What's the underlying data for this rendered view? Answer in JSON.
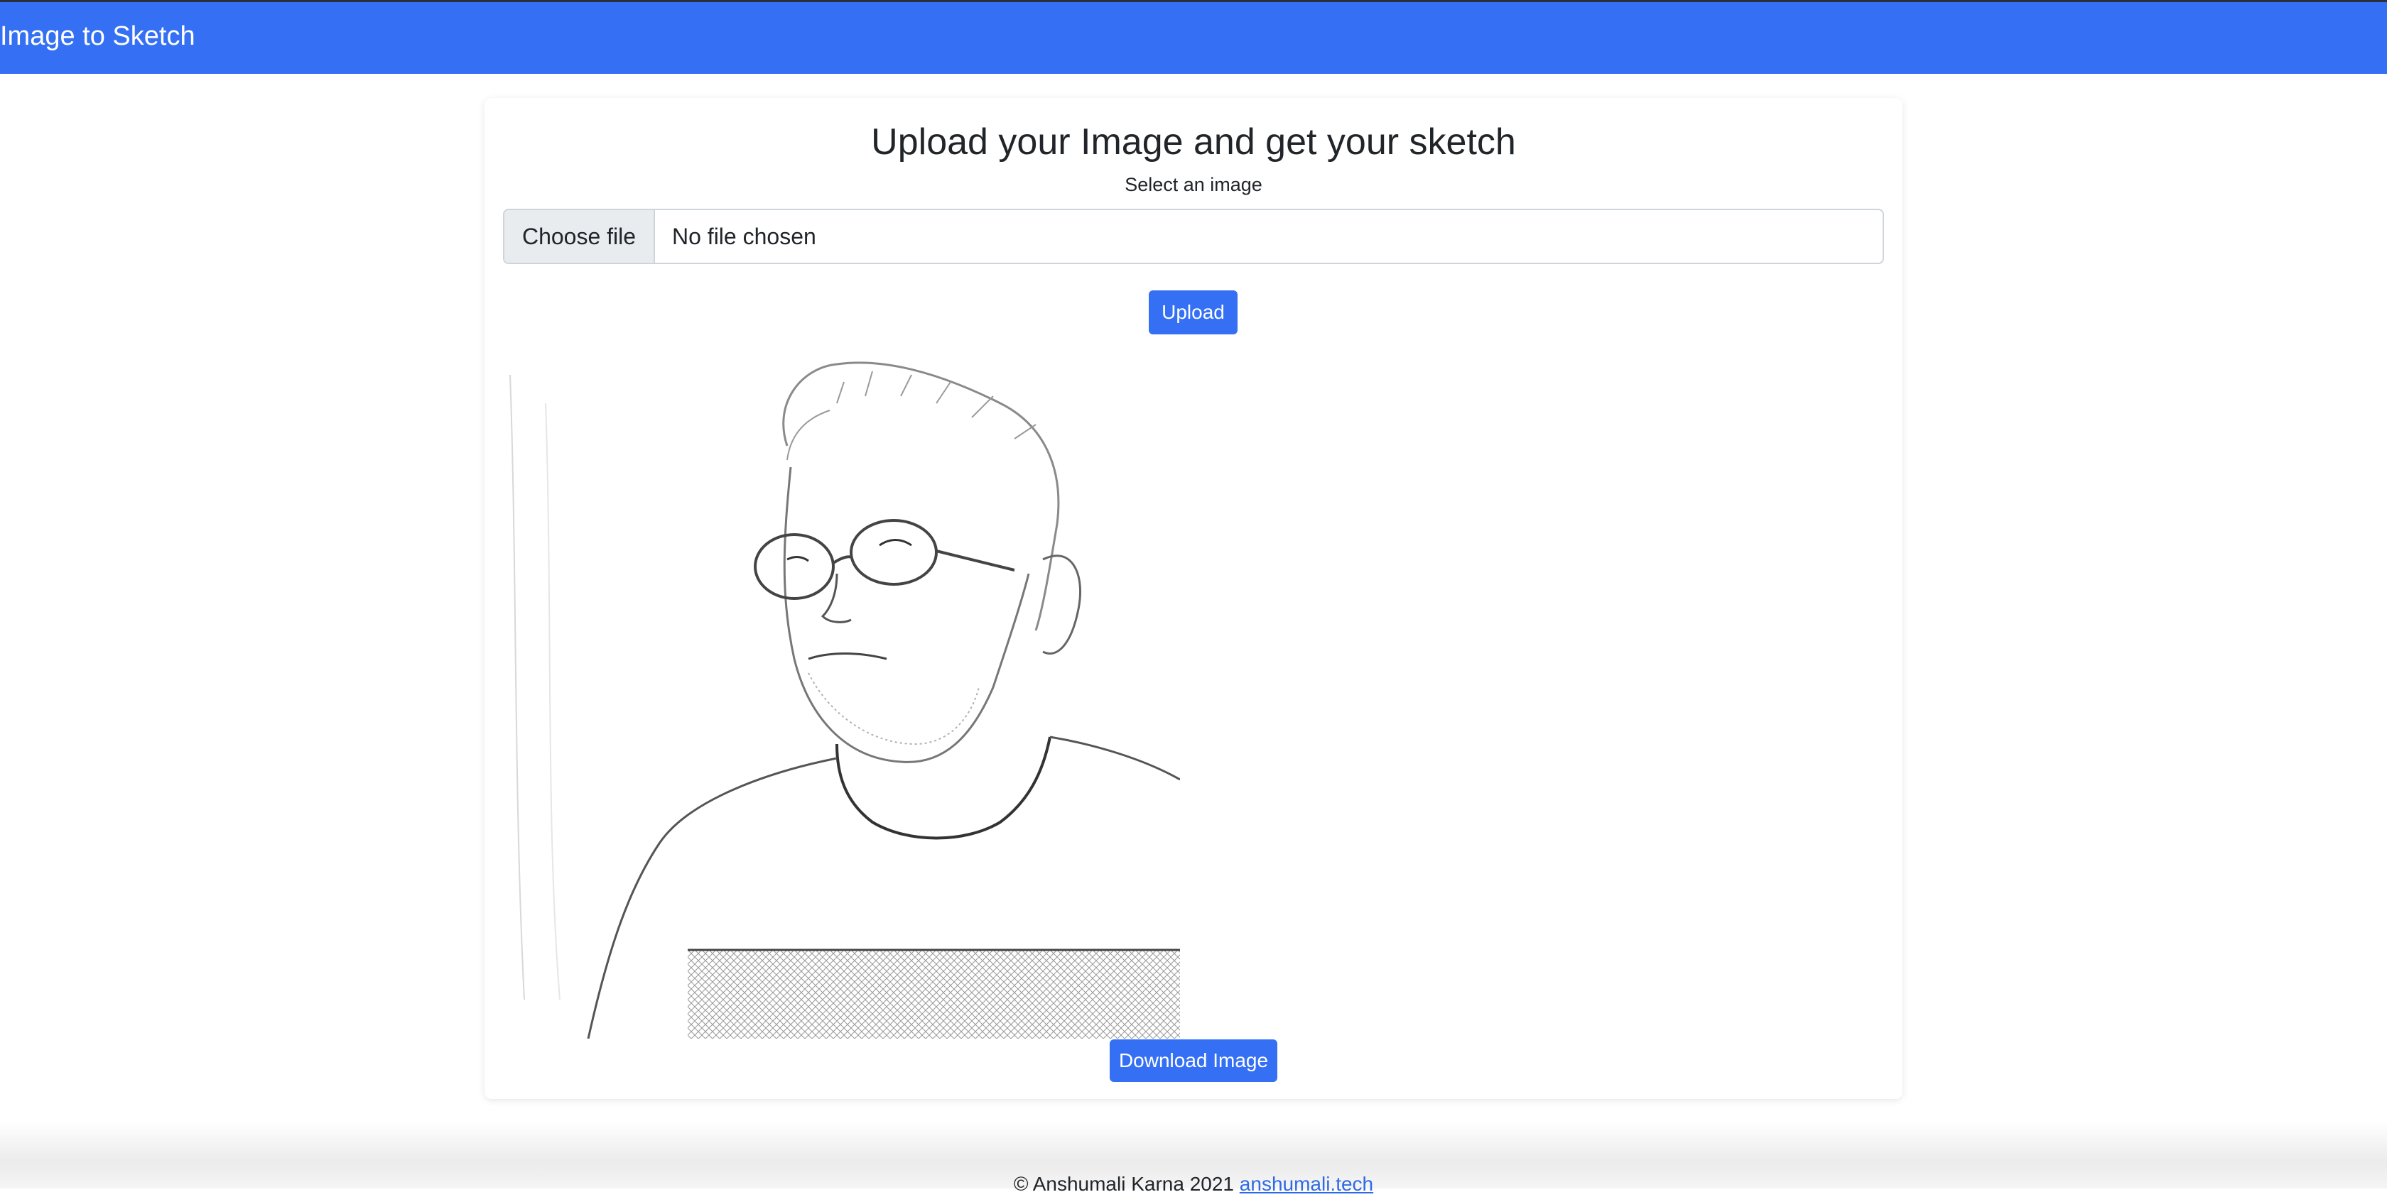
{
  "navbar": {
    "brand": "Image to Sketch",
    "background_color": "#3570f4"
  },
  "main": {
    "heading": "Upload your Image and get your sketch",
    "input_label": "Select an image",
    "file_input": {
      "button_label": "Choose file",
      "value": "No file chosen"
    },
    "upload_button_label": "Upload",
    "result_image": {
      "alt": "Pencil sketch of a man wearing glasses and a t-shirt"
    },
    "download_button_label": "Download Image",
    "accent_color": "#3570f4"
  },
  "footer": {
    "text": "© Anshumali Karna 2021",
    "link_text": "anshumali.tech"
  }
}
